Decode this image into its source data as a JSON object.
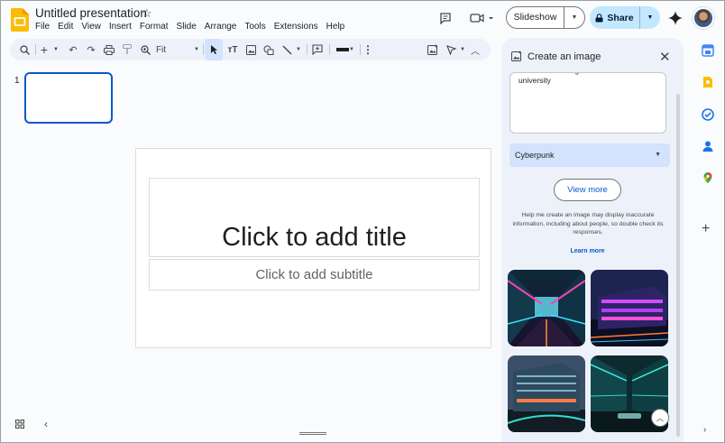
{
  "app": {
    "doc_title": "Untitled presentation",
    "menu": [
      "File",
      "Edit",
      "View",
      "Insert",
      "Format",
      "Slide",
      "Arrange",
      "Tools",
      "Extensions",
      "Help"
    ]
  },
  "header": {
    "slideshow_label": "Slideshow",
    "share_label": "Share"
  },
  "toolbar": {
    "zoom_value": "Fit"
  },
  "filmstrip": {
    "slide_number": "1"
  },
  "slide": {
    "title_placeholder": "Click to add title",
    "subtitle_placeholder": "Click to add subtitle"
  },
  "panel": {
    "title": "Create an image",
    "prompt_text": "an ultra-modern glass and steel university",
    "style_value": "Cyberpunk",
    "view_more_label": "View more",
    "disclaimer": "Help me create an image may display inaccurate information, including about people, so double check its responses.",
    "learn_more": "Learn more"
  },
  "colors": {
    "accent": "#0b57d0",
    "share_bg": "#c2e7ff",
    "panel_bg": "#edf2fa"
  }
}
